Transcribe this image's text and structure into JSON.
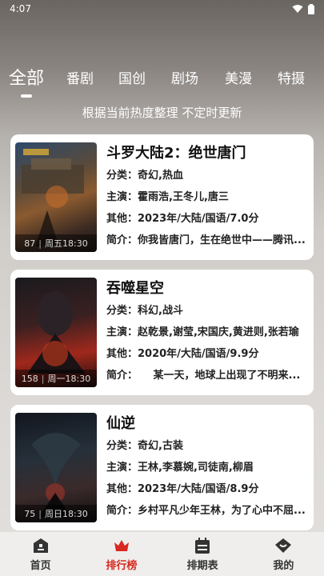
{
  "status_bar": {
    "time": "4:07"
  },
  "tabs": [
    {
      "label": "全部",
      "active": true
    },
    {
      "label": "番剧",
      "active": false
    },
    {
      "label": "国创",
      "active": false
    },
    {
      "label": "剧场",
      "active": false
    },
    {
      "label": "美漫",
      "active": false
    },
    {
      "label": "特摄",
      "active": false
    }
  ],
  "subtitle": "根据当前热度整理 不定时更新",
  "items": [
    {
      "title": "斗罗大陆2：绝世唐门",
      "category": "分类：奇幻,热血",
      "cast": "主演：霍雨浩,王冬儿,唐三",
      "other": "其他：2023年/大陆/国语/7.0分",
      "summary": "简介：你我皆唐门，生在绝世中——腾讯...",
      "episode": "87",
      "schedule": "周五18:30"
    },
    {
      "title": "吞噬星空",
      "category": "分类：科幻,战斗",
      "cast": "主演：赵乾景,谢莹,宋国庆,黄进则,张若瑜",
      "other": "其他：2020年/大陆/国语/9.9分",
      "summary": "简介：　　某一天，地球上出现了不明来...",
      "episode": "158",
      "schedule": "周一18:30"
    },
    {
      "title": "仙逆",
      "category": "分类：奇幻,古装",
      "cast": "主演：王林,李慕婉,司徒南,柳眉",
      "other": "其他：2023年/大陆/国语/8.9分",
      "summary": "简介：乡村平凡少年王林，为了心中不屈...",
      "episode": "75",
      "schedule": "周日18:30"
    }
  ],
  "bottom_nav": [
    {
      "label": "首页",
      "icon": "home-icon",
      "active": false
    },
    {
      "label": "排行榜",
      "icon": "crown-icon",
      "active": true
    },
    {
      "label": "排期表",
      "icon": "calendar-icon",
      "active": false
    },
    {
      "label": "我的",
      "icon": "profile-icon",
      "active": false
    }
  ],
  "colors": {
    "accent": "#d8281f",
    "nav_bg": "#efeeec"
  }
}
